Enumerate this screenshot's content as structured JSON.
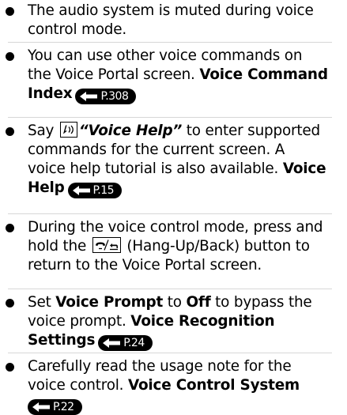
{
  "notes": [
    {
      "line1": "The audio system is muted during voice",
      "line2": "control mode."
    },
    {
      "line1": "You can use other voice commands on",
      "line2_pre": "the Voice Portal screen. ",
      "line2_bold": "Voice Command",
      "line3_bold": "Index",
      "ref": "P.308"
    },
    {
      "say": "Say",
      "quote": "“Voice Help”",
      "line1_post": " to enter supported",
      "line2": "commands for the current screen. A",
      "line3_pre": "voice help tutorial is also available. ",
      "line3_bold": "Voice",
      "line4_bold": "Help",
      "ref": "P.15"
    },
    {
      "line1": "During the voice control mode, press and",
      "line2_pre": "hold the ",
      "line2_post": " (Hang-Up/Back) button to",
      "line3": "return to the Voice Portal screen."
    },
    {
      "line1_pre": "Set ",
      "line1_bold1": "Voice Prompt",
      "line1_mid": " to ",
      "line1_bold2": "Off",
      "line1_post": " to bypass the",
      "line2_pre": "voice prompt. ",
      "line2_bold": "Voice Recognition",
      "line3_bold": "Settings",
      "ref": "P.24"
    },
    {
      "line1": "Carefully read the usage note for the",
      "line2_pre": "voice control. ",
      "line2_bold": "Voice Control System",
      "ref": "P.22"
    }
  ],
  "icons": {
    "bullet": "filled-circle",
    "talk": "talk-button-icon",
    "hangup": "hang-up-back-button-icon",
    "ref_arrow": "page-reference-arrow-icon"
  },
  "colors": {
    "text": "#000000",
    "divider": "#d7d7d7",
    "ref_badge_bg": "#000000",
    "ref_badge_fg": "#ffffff"
  }
}
